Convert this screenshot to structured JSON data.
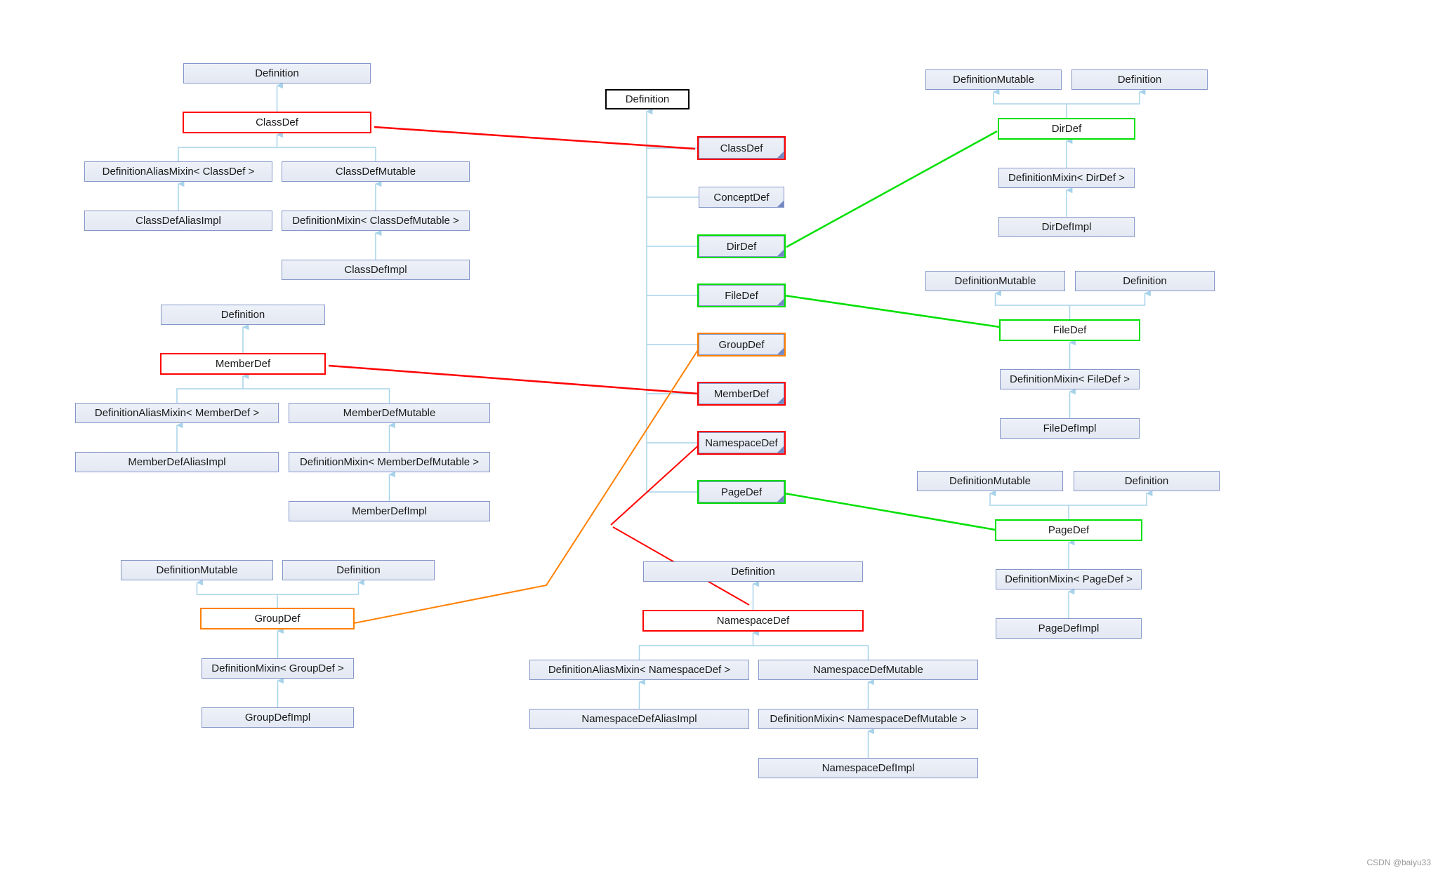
{
  "colors": {
    "edge": "#a7d3ea",
    "node_border": "#8597c9",
    "highlight_red": "#ff0000",
    "highlight_green": "#00e000",
    "highlight_orange": "#ff8000"
  },
  "watermark": "CSDN @baiyu33",
  "center_tree": {
    "root": "Definition",
    "children": [
      "ClassDef",
      "ConceptDef",
      "DirDef",
      "FileDef",
      "GroupDef",
      "MemberDef",
      "NamespaceDef",
      "PageDef"
    ],
    "highlights": {
      "ClassDef": "red",
      "DirDef": "green",
      "FileDef": "green",
      "GroupDef": "orange",
      "MemberDef": "red",
      "NamespaceDef": "red",
      "PageDef": "green"
    }
  },
  "groups": {
    "classdef": {
      "parent": "Definition",
      "self": "ClassDef",
      "highlight": "red",
      "left": [
        "DefinitionAliasMixin< ClassDef >",
        "ClassDefAliasImpl"
      ],
      "right": [
        "ClassDefMutable",
        "DefinitionMixin< ClassDefMutable >",
        "ClassDefImpl"
      ]
    },
    "memberdef": {
      "parent": "Definition",
      "self": "MemberDef",
      "highlight": "red",
      "left": [
        "DefinitionAliasMixin< MemberDef >",
        "MemberDefAliasImpl"
      ],
      "right": [
        "MemberDefMutable",
        "DefinitionMixin< MemberDefMutable >",
        "MemberDefImpl"
      ]
    },
    "groupdef": {
      "parents": [
        "DefinitionMutable",
        "Definition"
      ],
      "self": "GroupDef",
      "highlight": "orange",
      "chain": [
        "DefinitionMixin< GroupDef >",
        "GroupDefImpl"
      ]
    },
    "namespacedef": {
      "parent": "Definition",
      "self": "NamespaceDef",
      "highlight": "red",
      "left": [
        "DefinitionAliasMixin< NamespaceDef >",
        "NamespaceDefAliasImpl"
      ],
      "right": [
        "NamespaceDefMutable",
        "DefinitionMixin< NamespaceDefMutable >",
        "NamespaceDefImpl"
      ]
    },
    "dirdef": {
      "parents": [
        "DefinitionMutable",
        "Definition"
      ],
      "self": "DirDef",
      "highlight": "green",
      "chain": [
        "DefinitionMixin< DirDef >",
        "DirDefImpl"
      ]
    },
    "filedef": {
      "parents": [
        "DefinitionMutable",
        "Definition"
      ],
      "self": "FileDef",
      "highlight": "green",
      "chain": [
        "DefinitionMixin< FileDef >",
        "FileDefImpl"
      ]
    },
    "pagedef": {
      "parents": [
        "DefinitionMutable",
        "Definition"
      ],
      "self": "PageDef",
      "highlight": "green",
      "chain": [
        "DefinitionMixin< PageDef >",
        "PageDefImpl"
      ]
    }
  }
}
